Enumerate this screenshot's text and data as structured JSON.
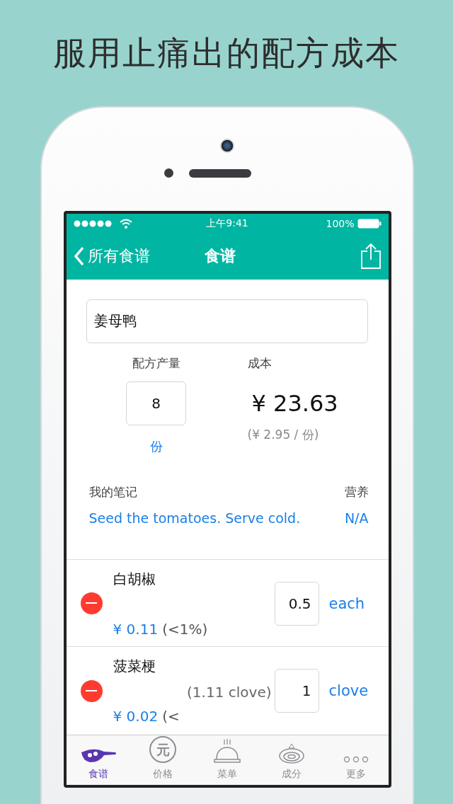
{
  "headline": "服用止痛出的配方成本",
  "status_bar": {
    "time": "上午9:41",
    "battery": "100%"
  },
  "nav": {
    "back": "所有食谱",
    "title": "食谱"
  },
  "recipe": {
    "name": "姜母鸭",
    "yield_label": "配方产量",
    "yield_value": "8",
    "yield_unit": "份",
    "cost_label": "成本",
    "cost": "¥ 23.63",
    "cost_per": "(¥ 2.95 / 份)",
    "notes_label": "我的笔记",
    "notes": "Seed the tomatoes. Serve cold.",
    "nutrition_label": "营养",
    "nutrition": "N/A"
  },
  "ingredients": [
    {
      "name": "白胡椒",
      "price": "¥ 0.11",
      "share": "(<1%)",
      "qty": "0.5",
      "unit": "each"
    },
    {
      "name": "菠菜梗",
      "conversion": "(1.11 clove)",
      "price": "¥ 0.02",
      "share": "(<",
      "qty": "1",
      "unit": "clove"
    }
  ],
  "tabs": [
    {
      "kind": "pan",
      "label": "食谱",
      "selected": true
    },
    {
      "kind": "coin",
      "icon_text": "元",
      "label": "价格",
      "selected": false
    },
    {
      "kind": "cloche",
      "label": "菜单",
      "selected": false
    },
    {
      "kind": "onion",
      "label": "成分",
      "selected": false
    },
    {
      "kind": "more",
      "label": "更多",
      "selected": false
    }
  ]
}
